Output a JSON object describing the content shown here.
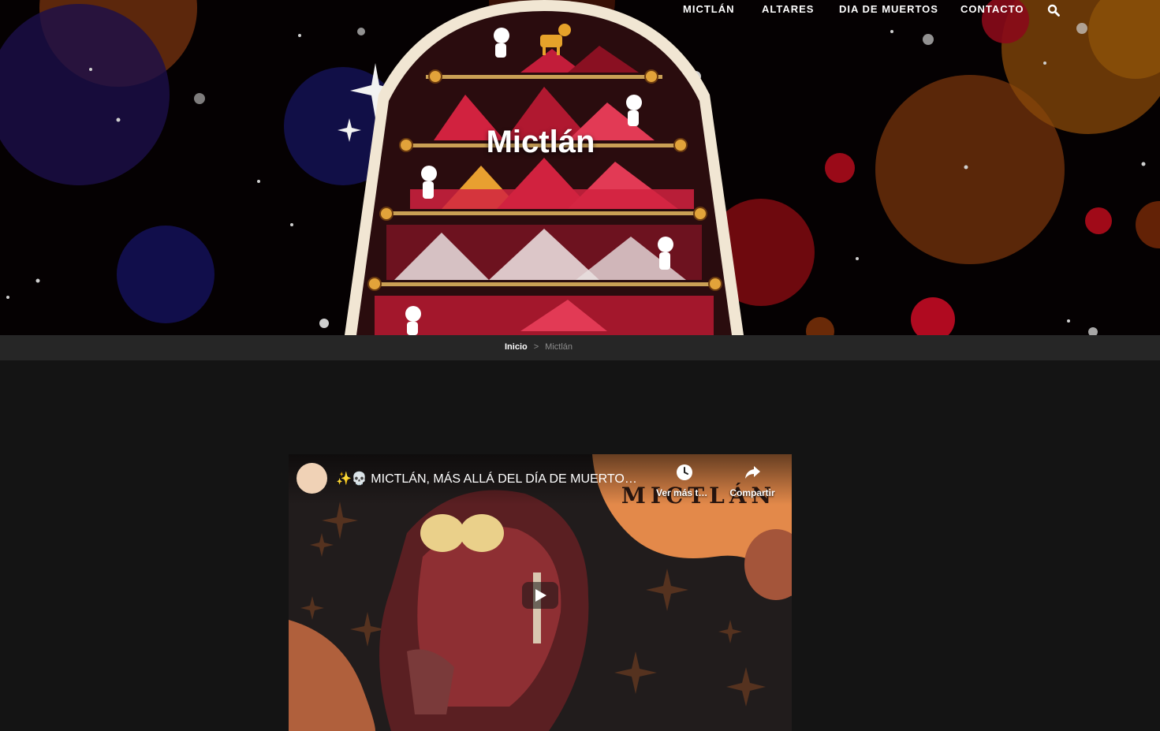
{
  "nav": {
    "items": [
      {
        "label": "MICTLÁN"
      },
      {
        "label": "ALTARES"
      },
      {
        "label": "DIA DE MUERTOS"
      },
      {
        "label": "CONTACTO"
      }
    ],
    "search_icon": "search-icon"
  },
  "hero": {
    "title": "Mictlán"
  },
  "breadcrumb": {
    "home": "Inicio",
    "separator": ">",
    "current": "Mictlán"
  },
  "video": {
    "title": "✨💀 MICTLÁN, MÁS ALLÁ DEL DÍA DE MUERTOS✨💀",
    "watch_later": "Ver más tarde",
    "share": "Compartir",
    "poster_text": "MICTLÁN",
    "icons": [
      "clock-icon",
      "share-icon",
      "play-icon"
    ]
  },
  "colors": {
    "background": "#141414",
    "breadcrumb_bar": "#262626",
    "accent_orange": "#e0843c",
    "accent_red": "#c8102e"
  }
}
